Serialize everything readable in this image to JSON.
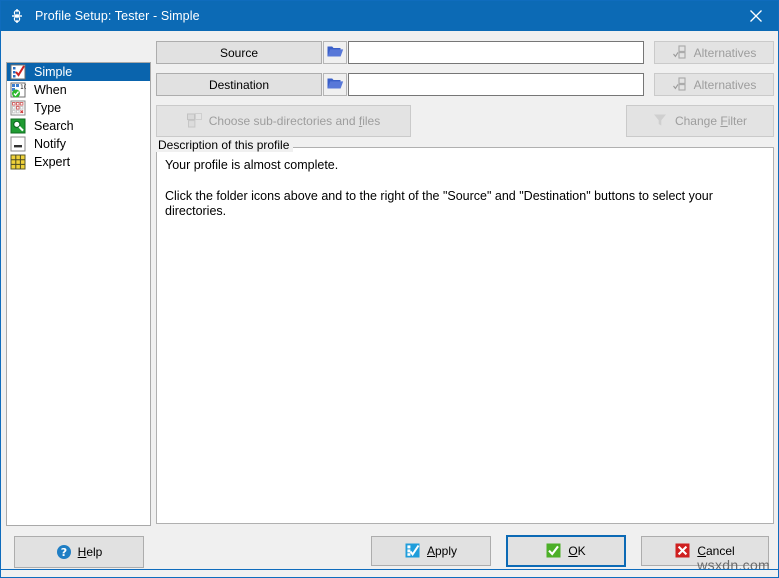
{
  "window": {
    "title": "Profile Setup: Tester - Simple",
    "app_icon": "app-gear-icon",
    "close_label": "✕",
    "accent_color": "#0c6ab5",
    "background_color": "#f0f0f0"
  },
  "sidebar": {
    "items": [
      {
        "label": "Simple",
        "icon": "simple-checkgrid-icon",
        "selected": true
      },
      {
        "label": "When",
        "icon": "when-calendar-icon",
        "selected": false
      },
      {
        "label": "Type",
        "icon": "type-grid-icon",
        "selected": false
      },
      {
        "label": "Search",
        "icon": "search-magnifier-icon",
        "selected": false
      },
      {
        "label": "Notify",
        "icon": "notify-bar-icon",
        "selected": false
      },
      {
        "label": "Expert",
        "icon": "expert-grid-icon",
        "selected": false
      }
    ]
  },
  "main": {
    "source": {
      "button_label": "Source",
      "folder_icon": "folder-icon",
      "path_value": "",
      "path_placeholder": "",
      "alternatives_label": "Alternatives",
      "alternatives_icon": "alternatives-icon",
      "alternatives_enabled": false
    },
    "destination": {
      "button_label": "Destination",
      "folder_icon": "folder-icon",
      "path_value": "",
      "path_placeholder": "",
      "alternatives_label": "Alternatives",
      "alternatives_icon": "alternatives-icon",
      "alternatives_enabled": false
    },
    "choose_subdirs": {
      "label_pre": "Choose sub-directories and ",
      "label_mnemonic": "f",
      "label_post": "iles",
      "icon": "folder-tree-icon",
      "enabled": false
    },
    "change_filter": {
      "label_pre": "Change ",
      "label_mnemonic": "F",
      "label_post": "ilter",
      "icon": "funnel-filter-icon",
      "enabled": false
    },
    "description": {
      "legend": "Description of this profile",
      "lines": [
        "Your profile is almost complete.",
        "Click the folder icons above and to the right of the \"Source\" and \"Destination\" buttons to select your directories."
      ]
    }
  },
  "footer": {
    "help": {
      "label_pre": "",
      "label_mnemonic": "H",
      "label_post": "elp",
      "icon": "help-question-icon"
    },
    "apply": {
      "label_pre": "",
      "label_mnemonic": "A",
      "label_post": "pply",
      "icon": "apply-checkbox-icon"
    },
    "ok": {
      "label_pre": "",
      "label_mnemonic": "O",
      "label_post": "K",
      "icon": "ok-check-icon",
      "focused": true
    },
    "cancel": {
      "label_pre": "",
      "label_mnemonic": "C",
      "label_post": "ancel",
      "icon": "cancel-x-icon"
    }
  },
  "watermark": {
    "text": "wsxdn.com"
  }
}
